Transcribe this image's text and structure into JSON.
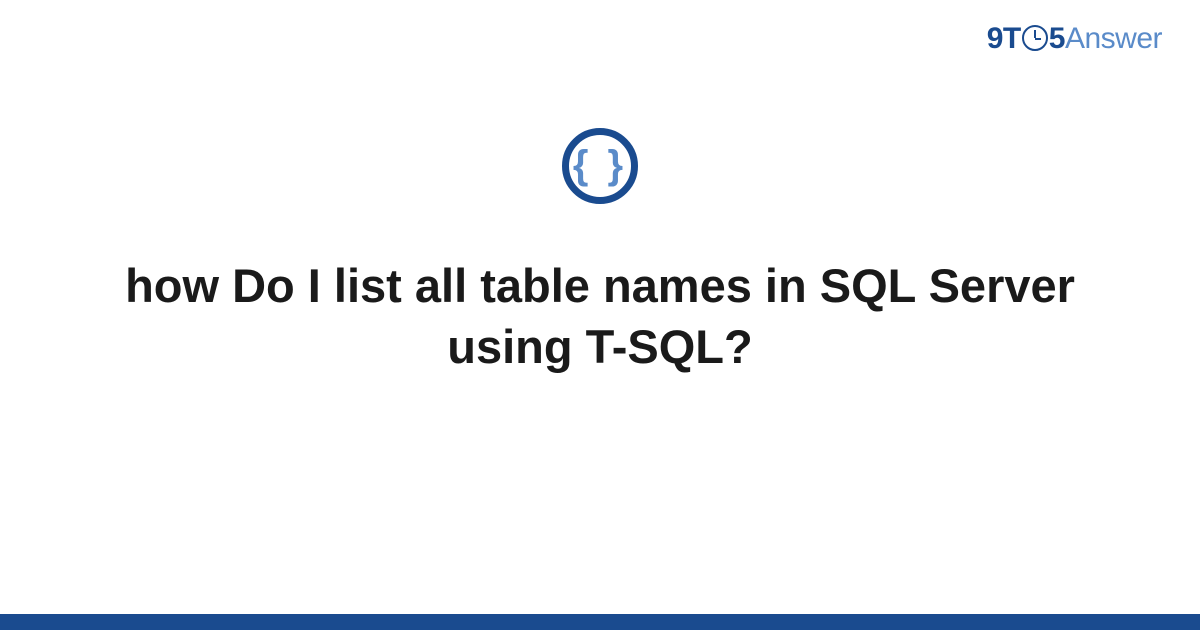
{
  "logo": {
    "part1": "9T",
    "part2": "5",
    "part3": "Answer"
  },
  "icon": {
    "braces": "{ }"
  },
  "question": {
    "title": "how Do I list all table names in SQL Server using T-SQL?"
  }
}
